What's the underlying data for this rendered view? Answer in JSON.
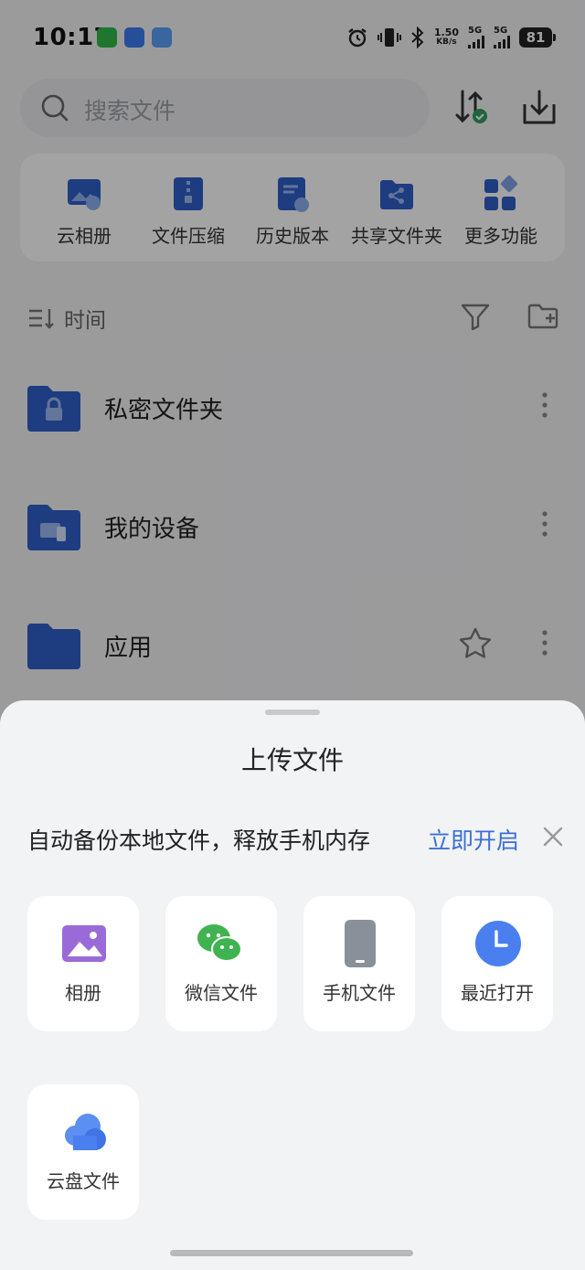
{
  "status_bar": {
    "time": "10:17",
    "net_speed_value": "1.50",
    "net_speed_unit": "KB/s",
    "sim1_label": "5G",
    "sim2_label": "5G",
    "battery": "81"
  },
  "search": {
    "placeholder": "搜索文件"
  },
  "quick_tools": [
    {
      "label": "云相册",
      "icon": "cloud-album-icon"
    },
    {
      "label": "文件压缩",
      "icon": "zip-icon"
    },
    {
      "label": "历史版本",
      "icon": "history-version-icon"
    },
    {
      "label": "共享文件夹",
      "icon": "shared-folder-icon"
    },
    {
      "label": "更多功能",
      "icon": "more-functions-icon"
    }
  ],
  "sort": {
    "label": "时间"
  },
  "files": [
    {
      "name": "私密文件夹",
      "icon": "lock-folder-icon"
    },
    {
      "name": "我的设备",
      "icon": "device-folder-icon"
    },
    {
      "name": "应用",
      "icon": "folder-icon"
    }
  ],
  "sheet": {
    "title": "上传文件",
    "backup_text": "自动备份本地文件，释放手机内存",
    "backup_link": "立即开启",
    "sources": [
      {
        "label": "相册",
        "icon": "gallery-icon"
      },
      {
        "label": "微信文件",
        "icon": "wechat-icon"
      },
      {
        "label": "手机文件",
        "icon": "phone-icon"
      },
      {
        "label": "最近打开",
        "icon": "clock-icon"
      },
      {
        "label": "云盘文件",
        "icon": "cloud-icon"
      }
    ]
  },
  "colors": {
    "accent": "#3b6fd6",
    "folder_blue": "#2f5fc8",
    "gallery_purple": "#9a6bd8",
    "wechat_green": "#3fb34f",
    "phone_gray": "#8a9099",
    "clock_blue": "#4a7ff0"
  }
}
